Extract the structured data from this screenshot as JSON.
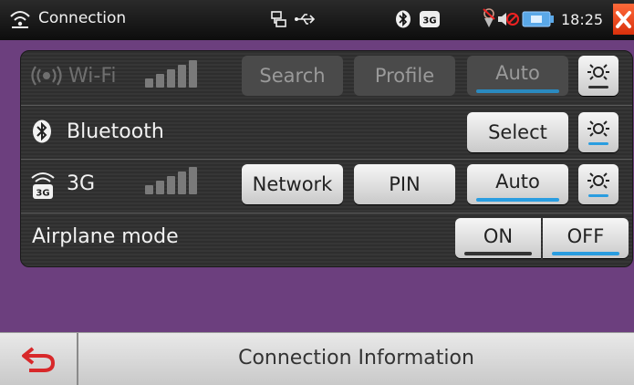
{
  "status_bar": {
    "title": "Connection",
    "time": "18:25",
    "icons": [
      "wifi-icon",
      "lan-icon",
      "usb-icon",
      "bluetooth-icon",
      "3g-icon",
      "gps-off-icon",
      "mute-icon",
      "battery-icon",
      "close-icon"
    ]
  },
  "rows": {
    "wifi": {
      "label": "Wi-Fi",
      "search": "Search",
      "profile": "Profile",
      "auto": "Auto",
      "enabled": false
    },
    "bluetooth": {
      "label": "Bluetooth",
      "select": "Select"
    },
    "g3": {
      "label": "3G",
      "network": "Network",
      "pin": "PIN",
      "auto": "Auto"
    },
    "airplane": {
      "label": "Airplane mode",
      "on": "ON",
      "off": "OFF",
      "selected": "OFF"
    }
  },
  "footer": {
    "title": "Connection Information"
  },
  "colors": {
    "accent": "#2a9de0",
    "background": "#6c3f7e",
    "close": "#e0401a"
  }
}
